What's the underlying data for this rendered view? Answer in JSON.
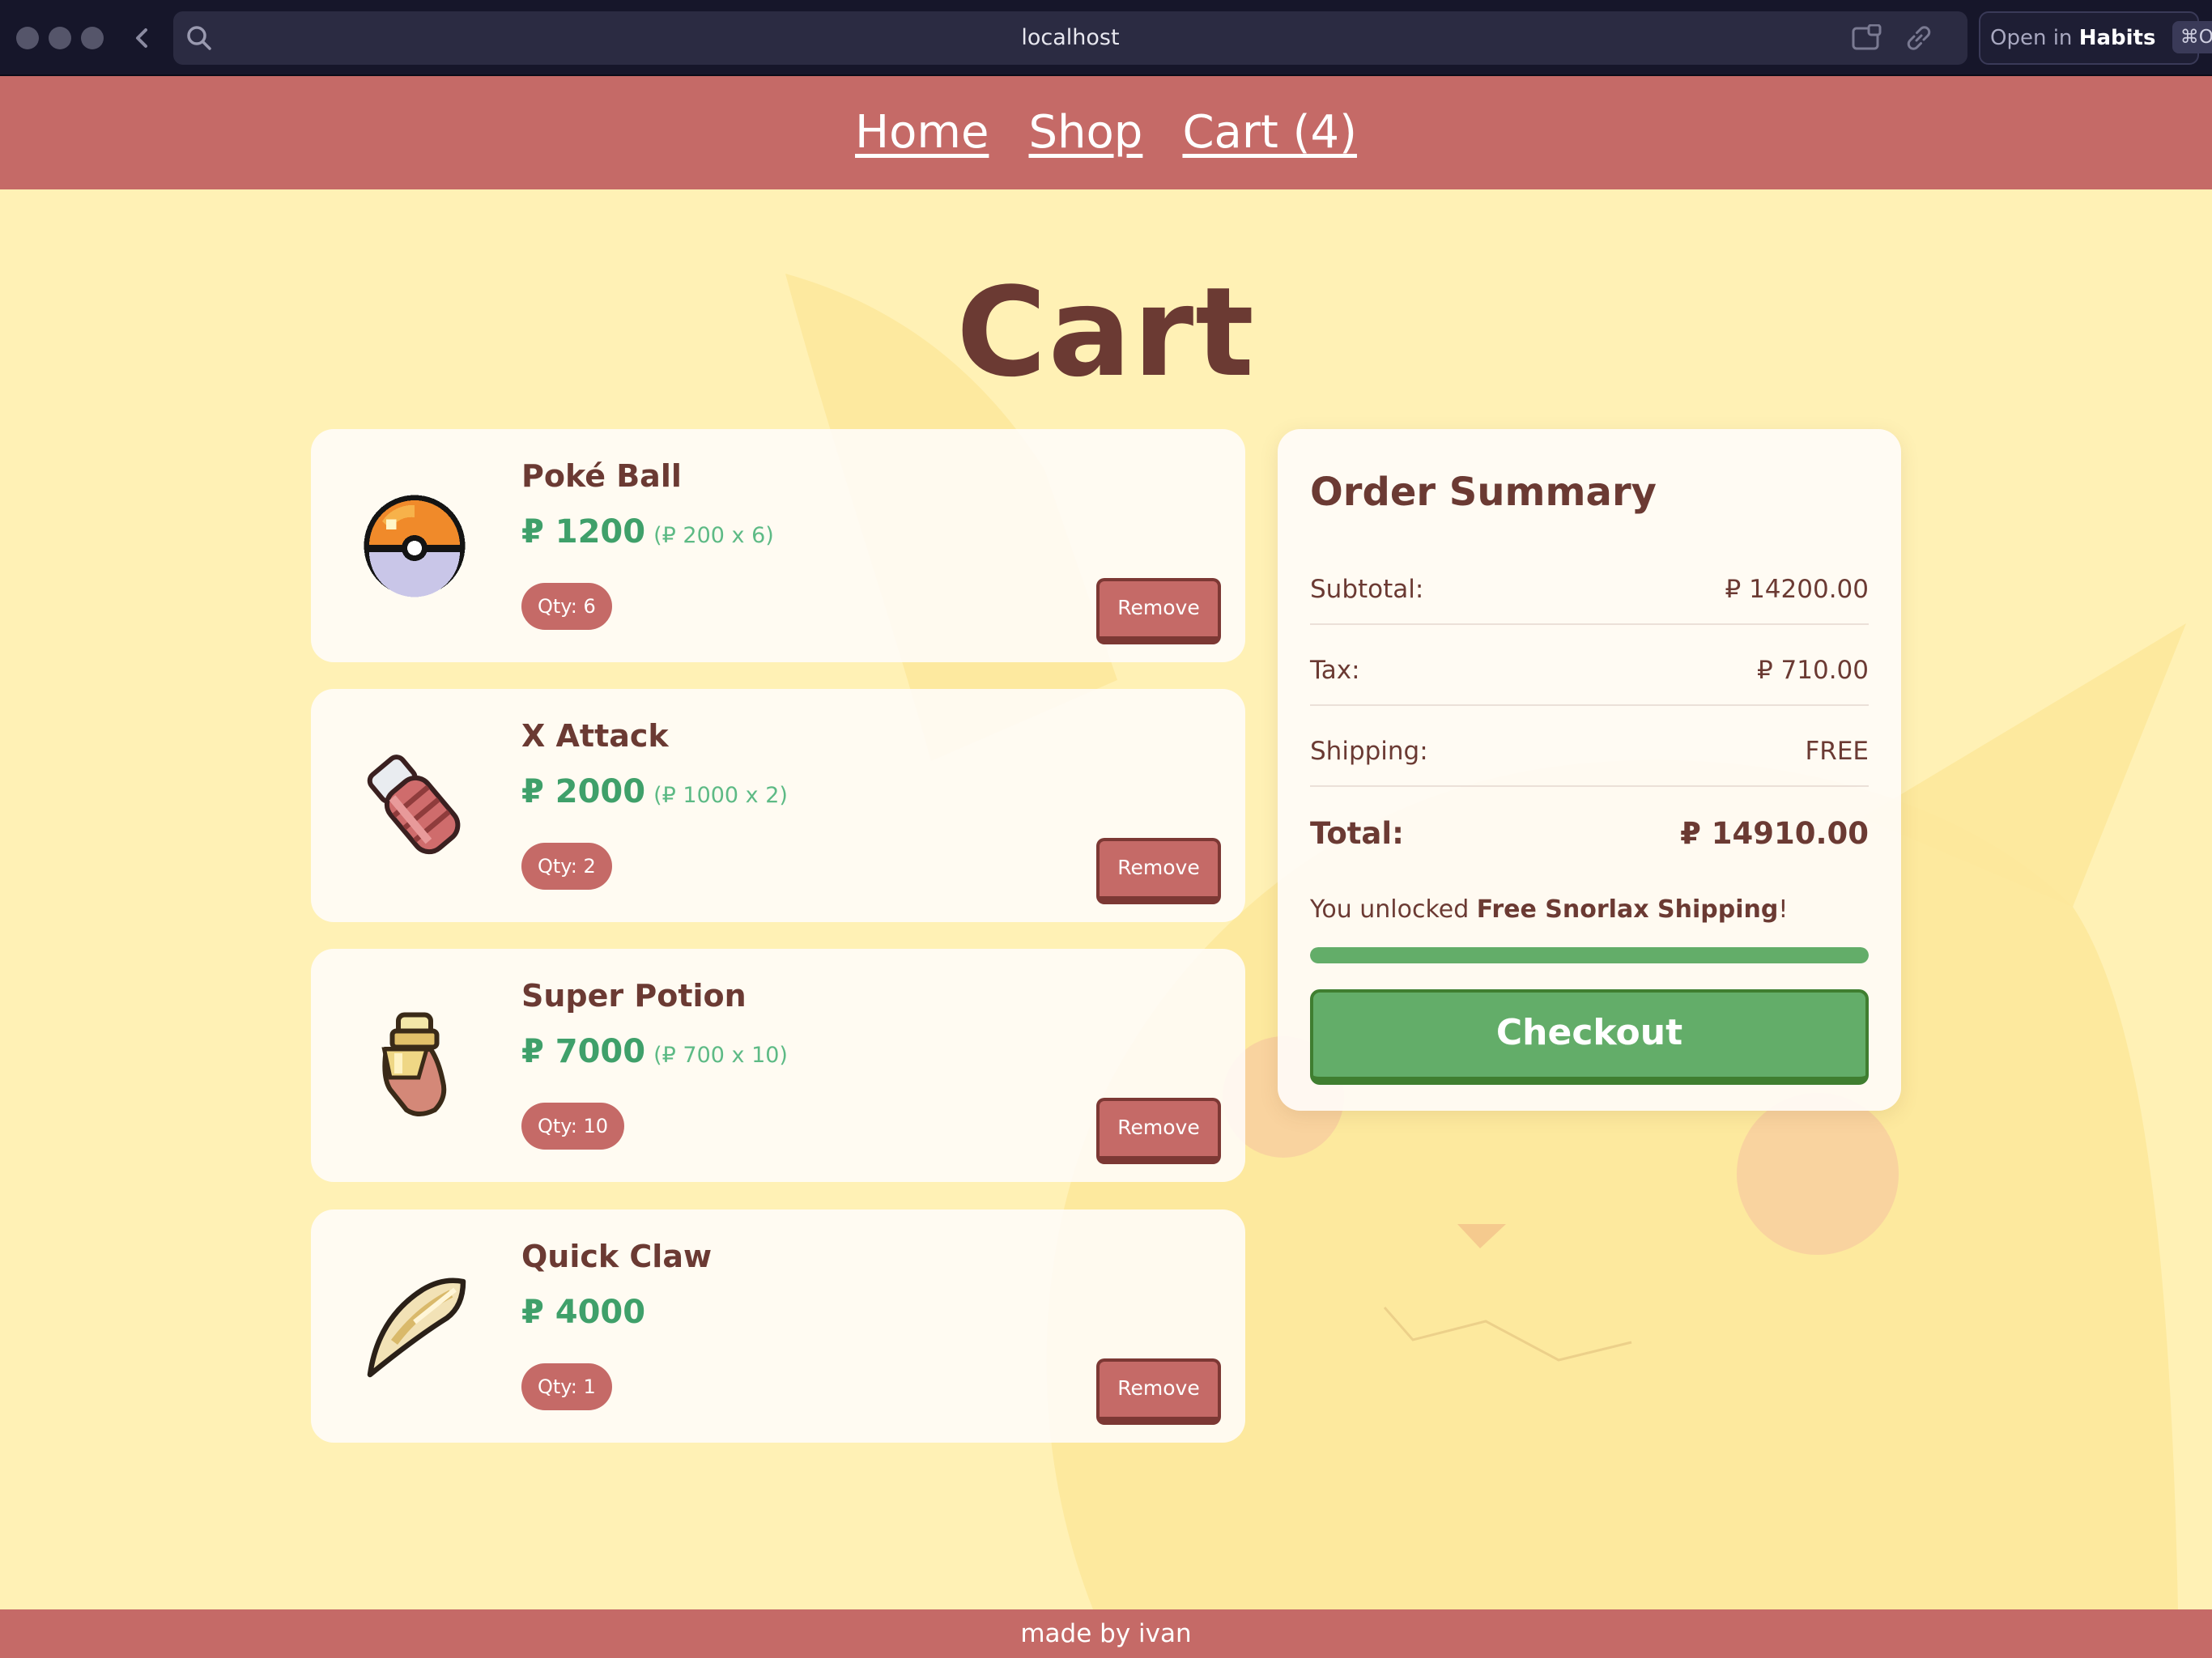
{
  "browser": {
    "url": "localhost",
    "open_in_prefix": "Open in",
    "open_in_app": "Habits",
    "open_in_shortcut": "⌘O"
  },
  "nav": {
    "home": "Home",
    "shop": "Shop",
    "cart": "Cart (4)"
  },
  "page": {
    "title": "Cart"
  },
  "cart": {
    "remove_label": "Remove",
    "items": [
      {
        "name": "Poké Ball",
        "price": "₽ 1200",
        "unit": "(₽ 200 x 6)",
        "qty": "Qty: 6",
        "sprite": "pokeball-icon"
      },
      {
        "name": "X Attack",
        "price": "₽ 2000",
        "unit": "(₽ 1000 x 2)",
        "qty": "Qty: 2",
        "sprite": "x-attack-icon"
      },
      {
        "name": "Super Potion",
        "price": "₽ 7000",
        "unit": "(₽ 700 x 10)",
        "qty": "Qty: 10",
        "sprite": "super-potion-icon"
      },
      {
        "name": "Quick Claw",
        "price": "₽ 4000",
        "unit": "",
        "qty": "Qty: 1",
        "sprite": "quick-claw-icon"
      }
    ]
  },
  "summary": {
    "title": "Order Summary",
    "subtotal_label": "Subtotal:",
    "subtotal_value": "₽ 14200.00",
    "tax_label": "Tax:",
    "tax_value": "₽ 710.00",
    "shipping_label": "Shipping:",
    "shipping_value": "FREE",
    "total_label": "Total:",
    "total_value": "₽ 14910.00",
    "unlock_prefix": "You unlocked ",
    "unlock_bold": "Free Snorlax Shipping",
    "unlock_suffix": "!",
    "shipping_progress_percent": 100,
    "checkout_label": "Checkout"
  },
  "footer": {
    "text": "made by ivan"
  },
  "colors": {
    "background": "#fff1b5",
    "nav": "#c56a67",
    "text": "#6b3a33",
    "price_green": "#3fa06a",
    "checkout_green": "#63ad69"
  }
}
